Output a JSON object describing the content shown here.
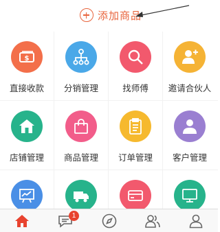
{
  "header": {
    "add_product_label": "添加商品"
  },
  "grid": {
    "items": [
      {
        "label": "直接收款",
        "color": "#f36f4a",
        "icon": "cash-icon"
      },
      {
        "label": "分销管理",
        "color": "#4aa8e8",
        "icon": "org-chart-icon"
      },
      {
        "label": "找师傅",
        "color": "#f2596d",
        "icon": "search-icon"
      },
      {
        "label": "邀请合伙人",
        "color": "#f5b335",
        "icon": "add-person-icon"
      },
      {
        "label": "店铺管理",
        "color": "#27b38b",
        "icon": "house-icon"
      },
      {
        "label": "商品管理",
        "color": "#f25d8a",
        "icon": "shopping-bag-icon"
      },
      {
        "label": "订单管理",
        "color": "#f6b92e",
        "icon": "clipboard-icon"
      },
      {
        "label": "客户管理",
        "color": "#9a7fd1",
        "icon": "person-icon"
      },
      {
        "label": "",
        "color": "#4a8fe6",
        "icon": "chart-board-icon"
      },
      {
        "label": "",
        "color": "#27b38b",
        "icon": "truck-icon"
      },
      {
        "label": "",
        "color": "#f2596d",
        "icon": "card-icon"
      },
      {
        "label": "",
        "color": "#27b38b",
        "icon": "monitor-icon"
      }
    ]
  },
  "tabbar": {
    "items": [
      {
        "name": "home-icon",
        "active": true
      },
      {
        "name": "message-icon",
        "badge": "1"
      },
      {
        "name": "compass-icon"
      },
      {
        "name": "people-icon"
      },
      {
        "name": "user-icon"
      }
    ],
    "active_color": "#e8432f",
    "inactive_color": "#666666"
  }
}
